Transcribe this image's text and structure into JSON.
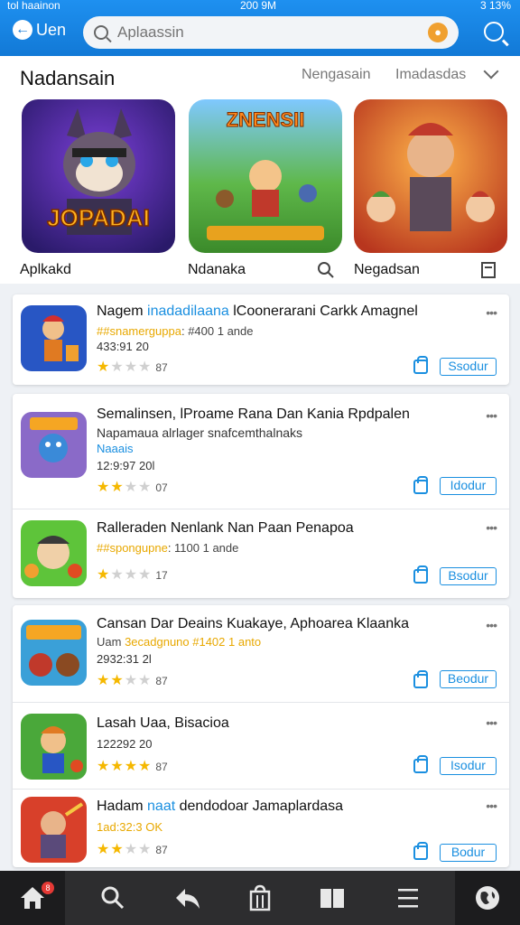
{
  "status": {
    "left": "tol haainon",
    "center": "200 9M",
    "right": "3 13%"
  },
  "topbar": {
    "back_label": "Uen",
    "search_placeholder": "Aplaassin"
  },
  "featured": {
    "title": "Nadansain",
    "tabs": [
      "Nengasain",
      "Imadasdas"
    ],
    "cards": [
      {
        "art_text": "JOPADAI",
        "caption": "Aplkakd"
      },
      {
        "art_text": "ZNENSII",
        "caption": "Ndanaka"
      },
      {
        "art_text": "",
        "caption": "Negadsan"
      }
    ]
  },
  "apps": [
    {
      "name_a": "Nagem ",
      "name_b": "inadadilaana",
      "name_c": " lCoonerarani Carkk Amagnel",
      "sub_hl": "##snamerguppa",
      "sub_rest": ": #400 1 ande",
      "date": "433:91 20",
      "rating": 1,
      "rating_label": "87",
      "button": "Ssodur"
    },
    {
      "name_a": "Semalinsen, lProame Rana Dan Kania Rpdpalen",
      "name_b": "",
      "name_c": "",
      "sub_hl": "",
      "sub_rest": "Napamaua alrlager snafcemthalnaks",
      "sub2": "Naaais",
      "date": "12:9:97 20l",
      "rating": 2,
      "rating_label": "07",
      "button": "Idodur"
    },
    {
      "name_a": "Ralleraden Nenlank Nan Paan Penapoa",
      "name_b": "",
      "name_c": "",
      "sub_hl": "##spongupne",
      "sub_rest": ": 1100 1 ande",
      "date": "",
      "rating": 1,
      "rating_label": "17",
      "button": "Bsodur"
    },
    {
      "name_a": "Cansan Dar Deains Kuakaye, Aphoarea Klaanka",
      "name_b": "",
      "name_c": "",
      "sub_hl": "Uam ",
      "sub_rest": "3ecadgnuno #1402 1 anto",
      "date": "2932:31 2l",
      "rating": 2,
      "rating_label": "87",
      "button": "Beodur"
    },
    {
      "name_a": "Lasah Uaa, ",
      "name_b": "",
      "name_c": "",
      "name_d": "Bisacioa",
      "sub_hl": "",
      "sub_rest": "",
      "date": "122292 20",
      "rating": 4,
      "rating_label": "87",
      "button": "Isodur"
    },
    {
      "name_a": "Hadam ",
      "name_b": "naat",
      "name_c": " dendodoar Jamaplardasa",
      "sub_hl": "",
      "sub_rest": "",
      "date": "1ad:32:3 OK",
      "rating": 2,
      "rating_label": "87",
      "button": "Bodur"
    }
  ],
  "colors": {
    "accent": "#1a8fe0",
    "star": "#f5b800",
    "nav_bg": "#2d2d2f"
  },
  "nav": [
    {
      "icon": "home-icon",
      "badge": "8"
    },
    {
      "icon": "search-icon"
    },
    {
      "icon": "back-reply-icon"
    },
    {
      "icon": "bag-icon"
    },
    {
      "icon": "book-icon"
    },
    {
      "icon": "menu-icon"
    },
    {
      "icon": "globe-icon"
    }
  ]
}
